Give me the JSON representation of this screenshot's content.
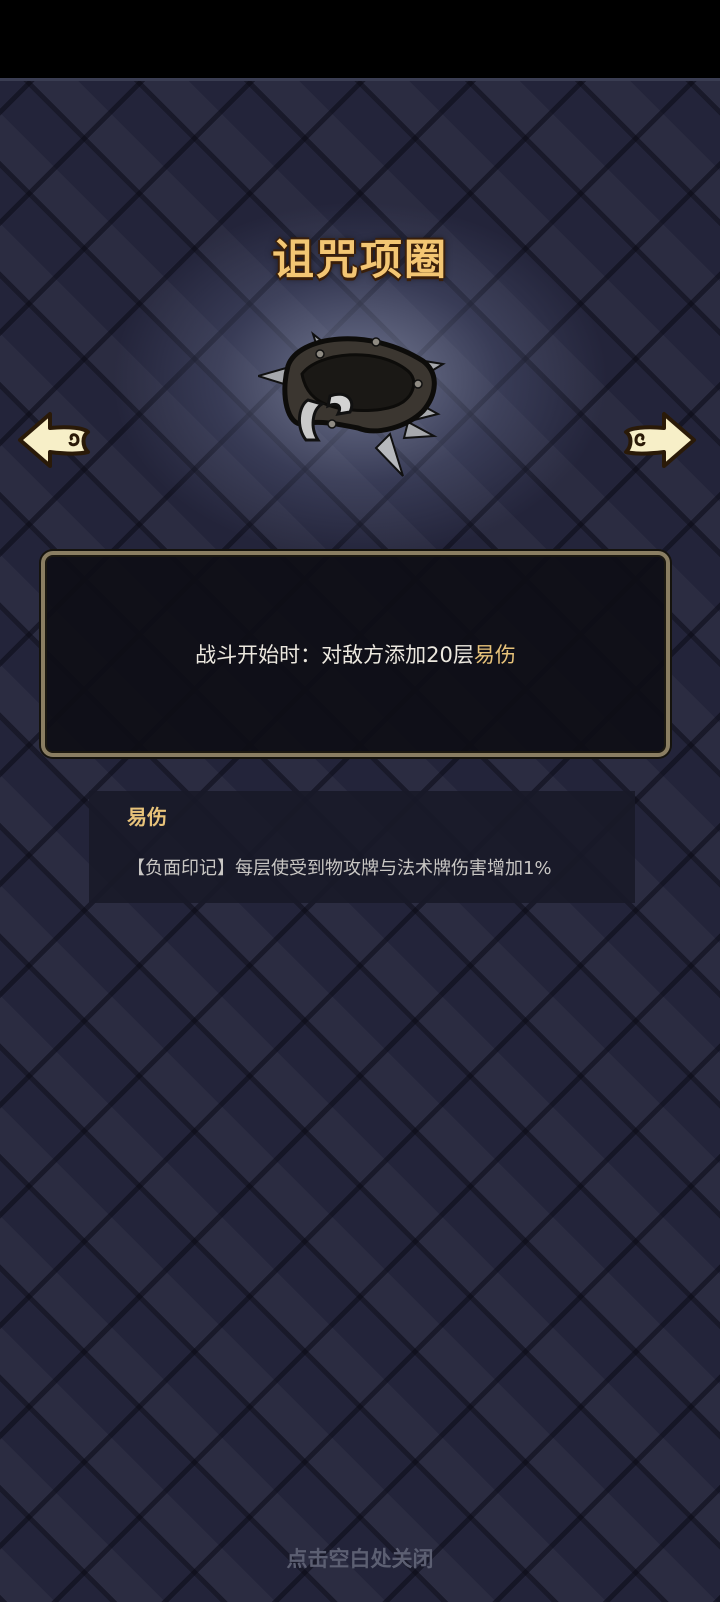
{
  "item": {
    "title": "诅咒项圈",
    "image_icon": "spiked-collar-icon"
  },
  "navigation": {
    "prev_icon": "arrow-left-icon",
    "next_icon": "arrow-right-icon"
  },
  "description": {
    "prefix": "战斗开始时：对敌方添加20层",
    "keyword": "易伤"
  },
  "keyword_panel": {
    "name": "易伤",
    "text": "【负面印记】每层使受到物攻牌与法术牌伤害增加1%"
  },
  "footer": {
    "close_hint": "点击空白处关闭"
  },
  "colors": {
    "title": "#f3c673",
    "keyword": "#e8c37a",
    "background": "#23243a",
    "box_border": "#8a7e62"
  }
}
